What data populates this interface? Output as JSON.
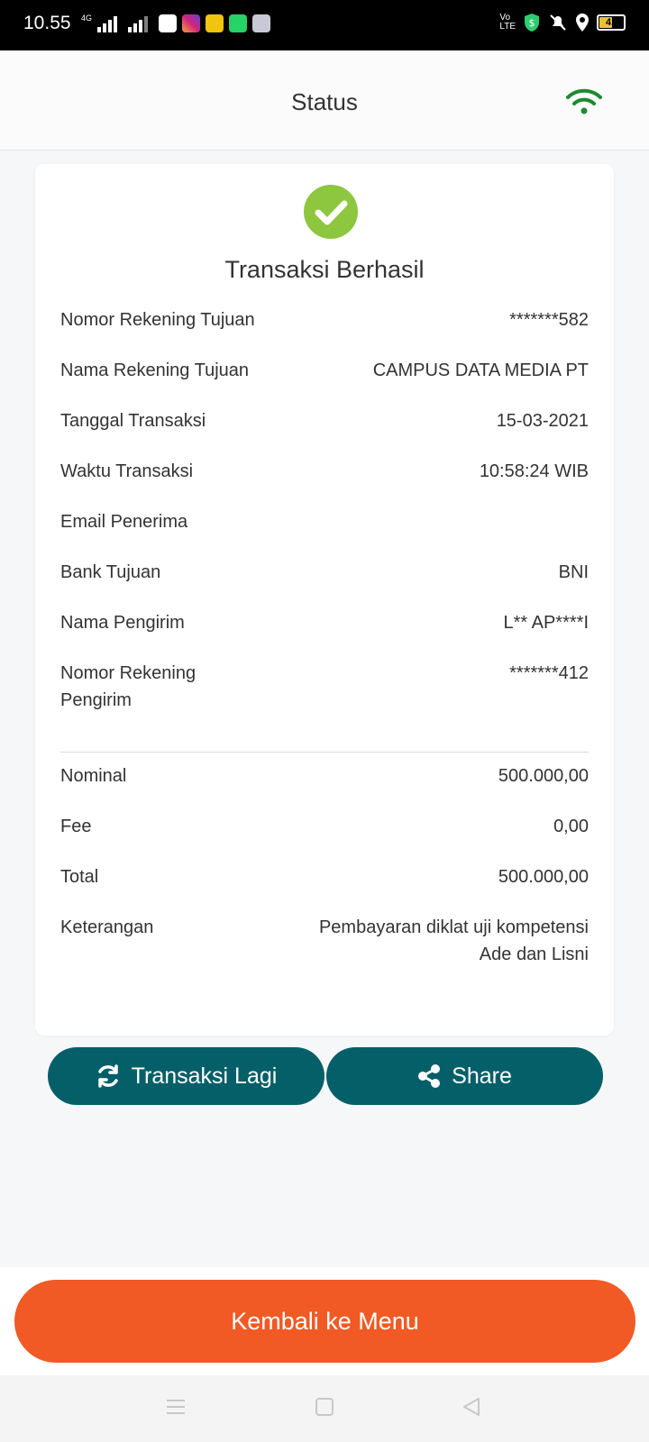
{
  "status_bar": {
    "time": "10.55",
    "network_label": "4G",
    "battery": "41"
  },
  "header": {
    "title": "Status",
    "icon": "wifi-icon",
    "icon_color": "#1e8a2f"
  },
  "receipt": {
    "status_icon": "check-circle-icon",
    "status_color": "#8dc63f",
    "title": "Transaksi Berhasil",
    "details": [
      {
        "label": "Nomor Rekening Tujuan",
        "value": "*******582"
      },
      {
        "label": "Nama Rekening Tujuan",
        "value": "CAMPUS DATA MEDIA PT"
      },
      {
        "label": "Tanggal Transaksi",
        "value": "15-03-2021"
      },
      {
        "label": "Waktu Transaksi",
        "value": "10:58:24 WIB"
      },
      {
        "label": "Email Penerima",
        "value": ""
      },
      {
        "label": "Bank Tujuan",
        "value": "BNI"
      },
      {
        "label": "Nama Pengirim",
        "value": "L** AP****I"
      },
      {
        "label": "Nomor Rekening Pengirim",
        "value": "*******412"
      }
    ],
    "amounts": [
      {
        "label": "Nominal",
        "value": "500.000,00"
      },
      {
        "label": "Fee",
        "value": "0,00"
      },
      {
        "label": "Total",
        "value": "500.000,00"
      },
      {
        "label": "Keterangan",
        "value": "Pembayaran diklat uji kompetensi Ade dan Lisni"
      }
    ]
  },
  "actions": {
    "repeat_label": "Transaksi Lagi",
    "share_label": "Share",
    "back_label": "Kembali ke Menu",
    "primary_color": "#045f68",
    "accent_color": "#f15a24"
  }
}
